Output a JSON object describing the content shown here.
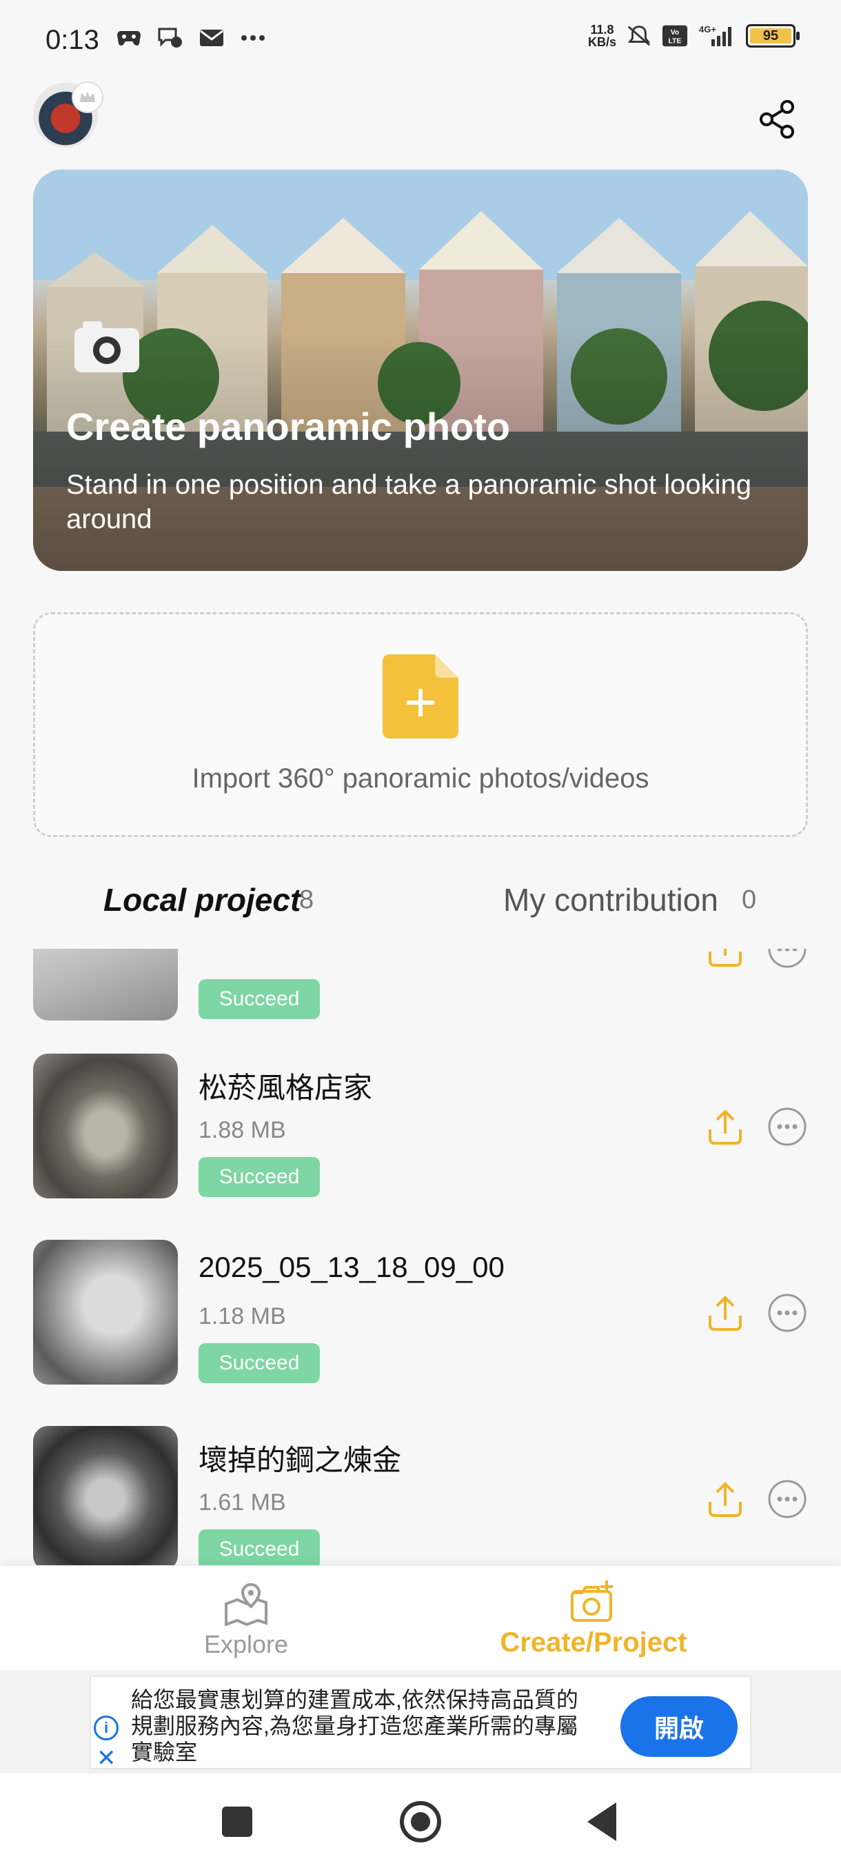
{
  "status_bar": {
    "time": "0:13",
    "net_speed_value": "11.8",
    "net_speed_unit": "KB/s",
    "network": "4G+",
    "volte": "Vo LTE",
    "battery": "95"
  },
  "header": {
    "share_icon": "share-icon"
  },
  "hero": {
    "title": "Create panoramic photo",
    "subtitle": "Stand in one position and take a panoramic shot looking around"
  },
  "import": {
    "label": "Import 360° panoramic photos/videos"
  },
  "tabs": {
    "local_label": "Local project",
    "local_count": "8",
    "contribution_label": "My contribution",
    "contribution_count": "0"
  },
  "projects": [
    {
      "name": "",
      "size": "",
      "status": "Succeed"
    },
    {
      "name": "松菸風格店家",
      "size": "1.88 MB",
      "status": "Succeed"
    },
    {
      "name": "2025_05_13_18_09_00",
      "size": "1.18 MB",
      "status": "Succeed"
    },
    {
      "name": "壞掉的鋼之煉金",
      "size": "1.61 MB",
      "status": "Succeed"
    }
  ],
  "bottom_nav": {
    "explore_label": "Explore",
    "create_label": "Create/Project",
    "active_color": "#f0b429"
  },
  "ad": {
    "text": "給您最實惠划算的建置成本,依然保持高品質的規劃服務內容,為您量身打造您產業所需的專屬實驗室",
    "button_label": "開啟"
  }
}
